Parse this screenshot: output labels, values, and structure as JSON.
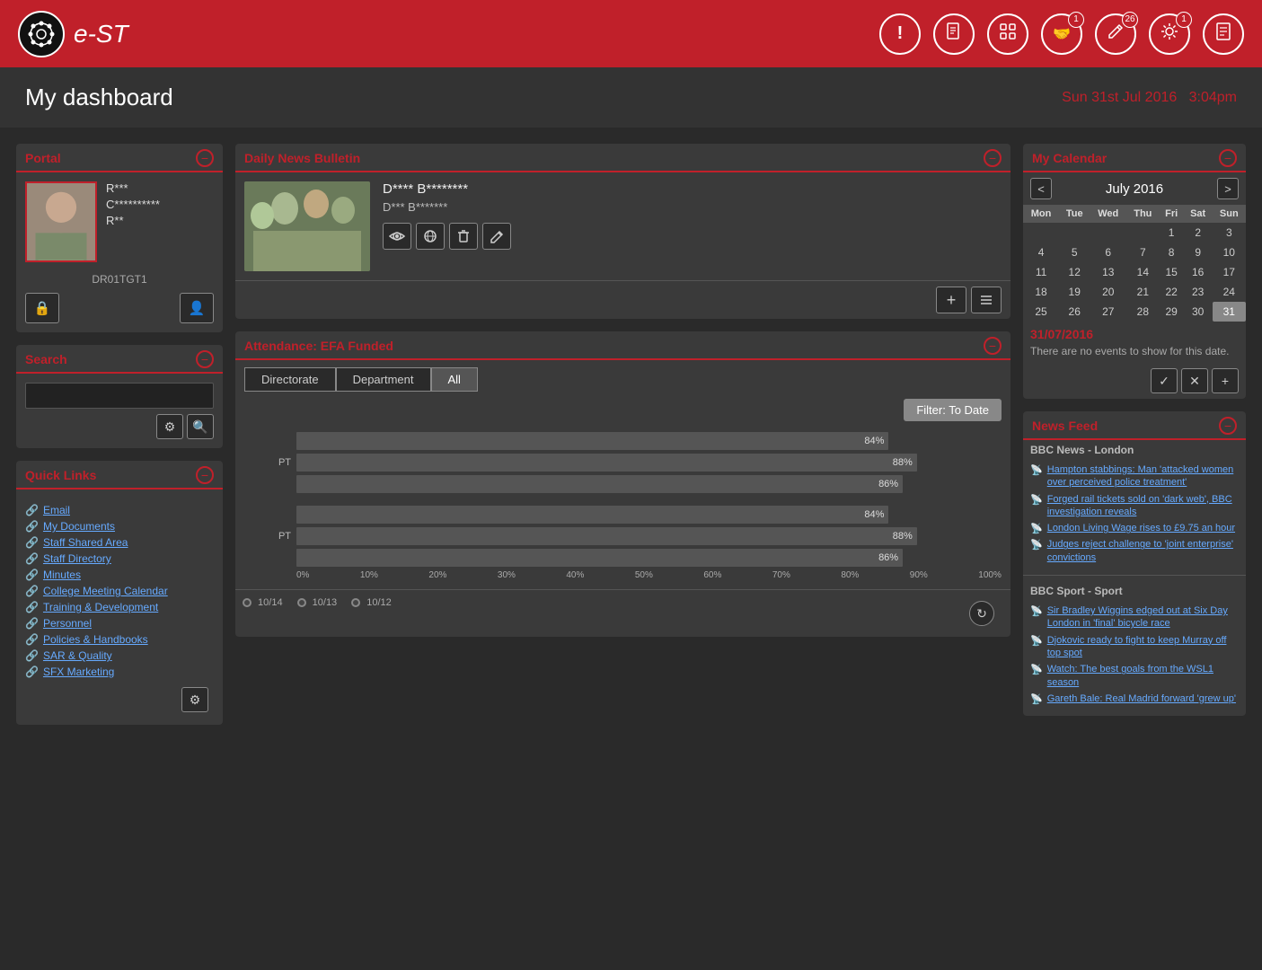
{
  "header": {
    "logo_icon": "⚙",
    "app_title": "e-ST",
    "icons": [
      {
        "name": "alert-icon",
        "symbol": "!",
        "badge": null
      },
      {
        "name": "document-icon",
        "symbol": "📋",
        "badge": null
      },
      {
        "name": "calendar-icon",
        "symbol": "⊞",
        "badge": null
      },
      {
        "name": "handshake-icon",
        "symbol": "🤝",
        "badge": "1"
      },
      {
        "name": "pencil-icon",
        "symbol": "✎",
        "badge": "26"
      },
      {
        "name": "sun-icon",
        "symbol": "✳",
        "badge": "1"
      },
      {
        "name": "notes-icon",
        "symbol": "📄",
        "badge": null
      }
    ]
  },
  "dashboard": {
    "title": "My dashboard",
    "date": "Sun 31st ",
    "date_highlight": "Jul",
    "date_year": " 2016",
    "time": "3:04pm"
  },
  "portal": {
    "title": "Portal",
    "name_line1": "R***",
    "name_line2": "C**********",
    "name_line3": "R**",
    "code": "DR01TGT1",
    "lock_btn": "🔒",
    "profile_btn": "👤"
  },
  "search": {
    "title": "Search",
    "placeholder": "",
    "settings_icon": "⚙",
    "search_icon": "🔍"
  },
  "quick_links": {
    "title": "Quick Links",
    "links": [
      "Email",
      "My Documents",
      "Staff Shared Area",
      "Staff Directory",
      "Minutes",
      "College Meeting Calendar",
      "Training & Development",
      "Personnel",
      "Policies & Handbooks",
      "SAR & Quality",
      "SFX Marketing"
    ]
  },
  "daily_news": {
    "title": "Daily News Bulletin",
    "news_title": "D**** B********",
    "news_subtitle": "D*** B*******",
    "actions": [
      "🔍",
      "🌐",
      "🗑",
      "✏"
    ]
  },
  "attendance": {
    "title": "Attendance: EFA Funded",
    "tabs": [
      "Directorate",
      "Department",
      "All"
    ],
    "active_tab": "All",
    "filter_label": "Filter: To Date",
    "bars_group1": [
      {
        "label": "",
        "value": 84,
        "pct": "84%"
      },
      {
        "label": "PT",
        "value": 88,
        "pct": "88%"
      },
      {
        "label": "",
        "value": 86,
        "pct": "86%"
      }
    ],
    "bars_group2": [
      {
        "label": "",
        "value": 84,
        "pct": "84%"
      },
      {
        "label": "PT",
        "value": 88,
        "pct": "88%"
      },
      {
        "label": "",
        "value": 86,
        "pct": "86%"
      }
    ],
    "x_axis": [
      "0%",
      "10%",
      "20%",
      "30%",
      "40%",
      "50%",
      "60%",
      "70%",
      "80%",
      "90%",
      "100%"
    ],
    "legend": [
      "10/14",
      "10/13",
      "10/12"
    ]
  },
  "calendar": {
    "title": "My Calendar",
    "month_year": "July 2016",
    "days_header": [
      "Mon",
      "Tue",
      "Wed",
      "Thu",
      "Fri",
      "Sat",
      "Sun"
    ],
    "weeks": [
      [
        "",
        "",
        "",
        "",
        "1",
        "2",
        "3"
      ],
      [
        "4",
        "5",
        "6",
        "7",
        "8",
        "9",
        "10"
      ],
      [
        "11",
        "12",
        "13",
        "14",
        "15",
        "16",
        "17"
      ],
      [
        "18",
        "19",
        "20",
        "21",
        "22",
        "23",
        "24"
      ],
      [
        "25",
        "26",
        "27",
        "28",
        "29",
        "30",
        "31"
      ]
    ],
    "today": "31",
    "selected_date": "31/07/2016",
    "no_events_text": "There are no events to show for this date."
  },
  "news_feed": {
    "title": "News Feed",
    "sections": [
      {
        "source": "BBC News - London",
        "items": [
          "Hampton stabbings: Man 'attacked women over perceived police treatment'",
          "Forged rail tickets sold on 'dark web', BBC investigation reveals",
          "London Living Wage rises to £9.75 an hour",
          "Judges reject challenge to 'joint enterprise' convictions"
        ]
      },
      {
        "source": "BBC Sport - Sport",
        "items": [
          "Sir Bradley Wiggins edged out at Six Day London in 'final' bicycle race",
          "Djokovic ready to fight to keep Murray off top spot",
          "Watch: The best goals from the WSL1 season",
          "Gareth Bale: Real Madrid forward 'grew up'"
        ]
      }
    ]
  }
}
